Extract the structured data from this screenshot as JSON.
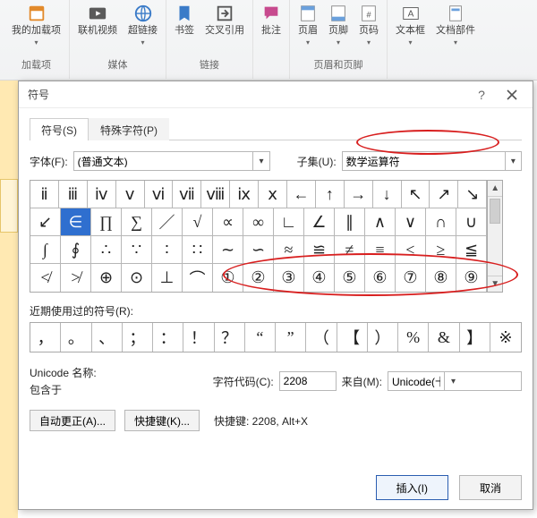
{
  "ribbon": {
    "groups": [
      {
        "label": "加载项",
        "items": [
          {
            "name": "addins",
            "label": "我的加载项",
            "has_dd": true
          }
        ]
      },
      {
        "label": "媒体",
        "items": [
          {
            "name": "online-video",
            "label": "联机视频"
          },
          {
            "name": "hyperlink",
            "label": "超链接",
            "has_dd": true
          }
        ]
      },
      {
        "label": "链接",
        "items": [
          {
            "name": "bookmark",
            "label": "书签"
          },
          {
            "name": "crossref",
            "label": "交叉引用"
          }
        ]
      },
      {
        "label": "",
        "items": [
          {
            "name": "comment",
            "label": "批注"
          }
        ]
      },
      {
        "label": "页眉和页脚",
        "items": [
          {
            "name": "header",
            "label": "页眉",
            "has_dd": true
          },
          {
            "name": "footer",
            "label": "页脚",
            "has_dd": true
          },
          {
            "name": "pagenum",
            "label": "页码",
            "has_dd": true
          }
        ]
      },
      {
        "label": "",
        "items": [
          {
            "name": "textbox",
            "label": "文本框",
            "has_dd": true
          },
          {
            "name": "docparts",
            "label": "文档部件",
            "has_dd": true
          }
        ]
      }
    ]
  },
  "dialog": {
    "title": "符号",
    "tabs": {
      "symbols": "符号(S)",
      "special": "特殊字符(P)"
    },
    "font_label": "字体(F):",
    "font_value": "(普通文本)",
    "subset_label": "子集(U):",
    "subset_value": "数学运算符",
    "grid_rows": [
      [
        "ⅱ",
        "ⅲ",
        "ⅳ",
        "ⅴ",
        "ⅵ",
        "ⅶ",
        "ⅷ",
        "ⅸ",
        "ⅹ",
        "←",
        "↑",
        "→",
        "↓",
        "↖",
        "↗",
        "↘"
      ],
      [
        "↙",
        "∈",
        "∏",
        "∑",
        "／",
        "√",
        "∝",
        "∞",
        "∟",
        "∠",
        "∥",
        "∧",
        "∨",
        "∩",
        "∪"
      ],
      [
        "∫",
        "∮",
        "∴",
        "∵",
        "∶",
        "∷",
        "∼",
        "∽",
        "≈",
        "≌",
        "≠",
        "≡",
        "≤",
        "≥",
        "≦"
      ],
      [
        "≮",
        "≯",
        "⊕",
        "⊙",
        "⊥",
        "⌒",
        "①",
        "②",
        "③",
        "④",
        "⑤",
        "⑥",
        "⑦",
        "⑧",
        "⑨"
      ]
    ],
    "selected": {
      "row": 1,
      "col": 1
    },
    "recent_label": "近期使用过的符号(R):",
    "recent": [
      "，",
      "。",
      "、",
      "；",
      "：",
      "！",
      "？",
      "“",
      "”",
      "（",
      "【",
      "）",
      "%",
      "&",
      "】",
      "※"
    ],
    "uname_label": "Unicode 名称:",
    "uname_value": "包含于",
    "code_label": "字符代码(C):",
    "code_value": "2208",
    "from_label": "来自(M):",
    "from_value": "Unicode(十六进制)",
    "autocorrect": "自动更正(A)...",
    "shortcutkey": "快捷键(K)...",
    "shortcut_label": "快捷键: 2208, Alt+X",
    "insert": "插入(I)",
    "cancel": "取消"
  }
}
